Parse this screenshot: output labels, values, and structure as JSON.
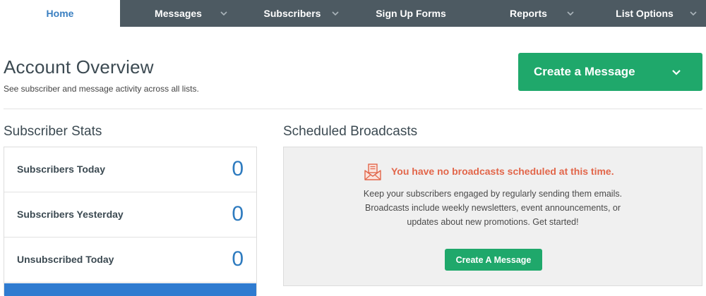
{
  "nav": {
    "items": [
      {
        "label": "Home",
        "active": true
      },
      {
        "label": "Messages",
        "has_dropdown": true
      },
      {
        "label": "Subscribers",
        "has_dropdown": true
      },
      {
        "label": "Sign Up Forms"
      },
      {
        "label": "Reports",
        "has_dropdown": true
      },
      {
        "label": "List Options",
        "has_dropdown": true
      }
    ]
  },
  "header": {
    "title": "Account Overview",
    "subtitle": "See subscriber and message activity across all lists.",
    "create_button_label": "Create a Message"
  },
  "subscriber_stats": {
    "title": "Subscriber Stats",
    "rows": [
      {
        "label": "Subscribers Today",
        "value": "0"
      },
      {
        "label": "Subscribers Yesterday",
        "value": "0"
      },
      {
        "label": "Unsubscribed Today",
        "value": "0"
      }
    ]
  },
  "scheduled_broadcasts": {
    "title": "Scheduled Broadcasts",
    "empty_heading": "You have no broadcasts scheduled at this time.",
    "empty_lines": [
      "Keep your subscribers engaged by regularly sending them emails.",
      "Broadcasts include weekly newsletters, event announcements, or",
      "updates about new promotions. Get started!"
    ],
    "button_label": "Create A Message"
  },
  "colors": {
    "nav_bg": "#4d5a62",
    "accent_green": "#1fa86b",
    "stat_blue": "#2e7bbf",
    "warning_orange": "#e2664a"
  },
  "icons": {
    "dropdown": "chevron-down-icon",
    "empty_state": "envelope-document-icon"
  }
}
